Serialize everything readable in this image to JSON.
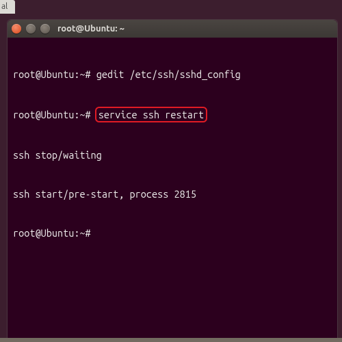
{
  "partial_tab": "al",
  "window": {
    "title": "root@Ubuntu: ~"
  },
  "terminal": {
    "lines": {
      "l0_prompt": "root@Ubuntu:~# ",
      "l0_cmd": "gedit /etc/ssh/sshd_config",
      "l1_prompt": "root@Ubuntu:~# ",
      "l1_cmd_highlighted": "service ssh restart",
      "l2": "ssh stop/waiting",
      "l3": "ssh start/pre-start, process 2815",
      "l4_prompt": "root@Ubuntu:~# "
    }
  }
}
